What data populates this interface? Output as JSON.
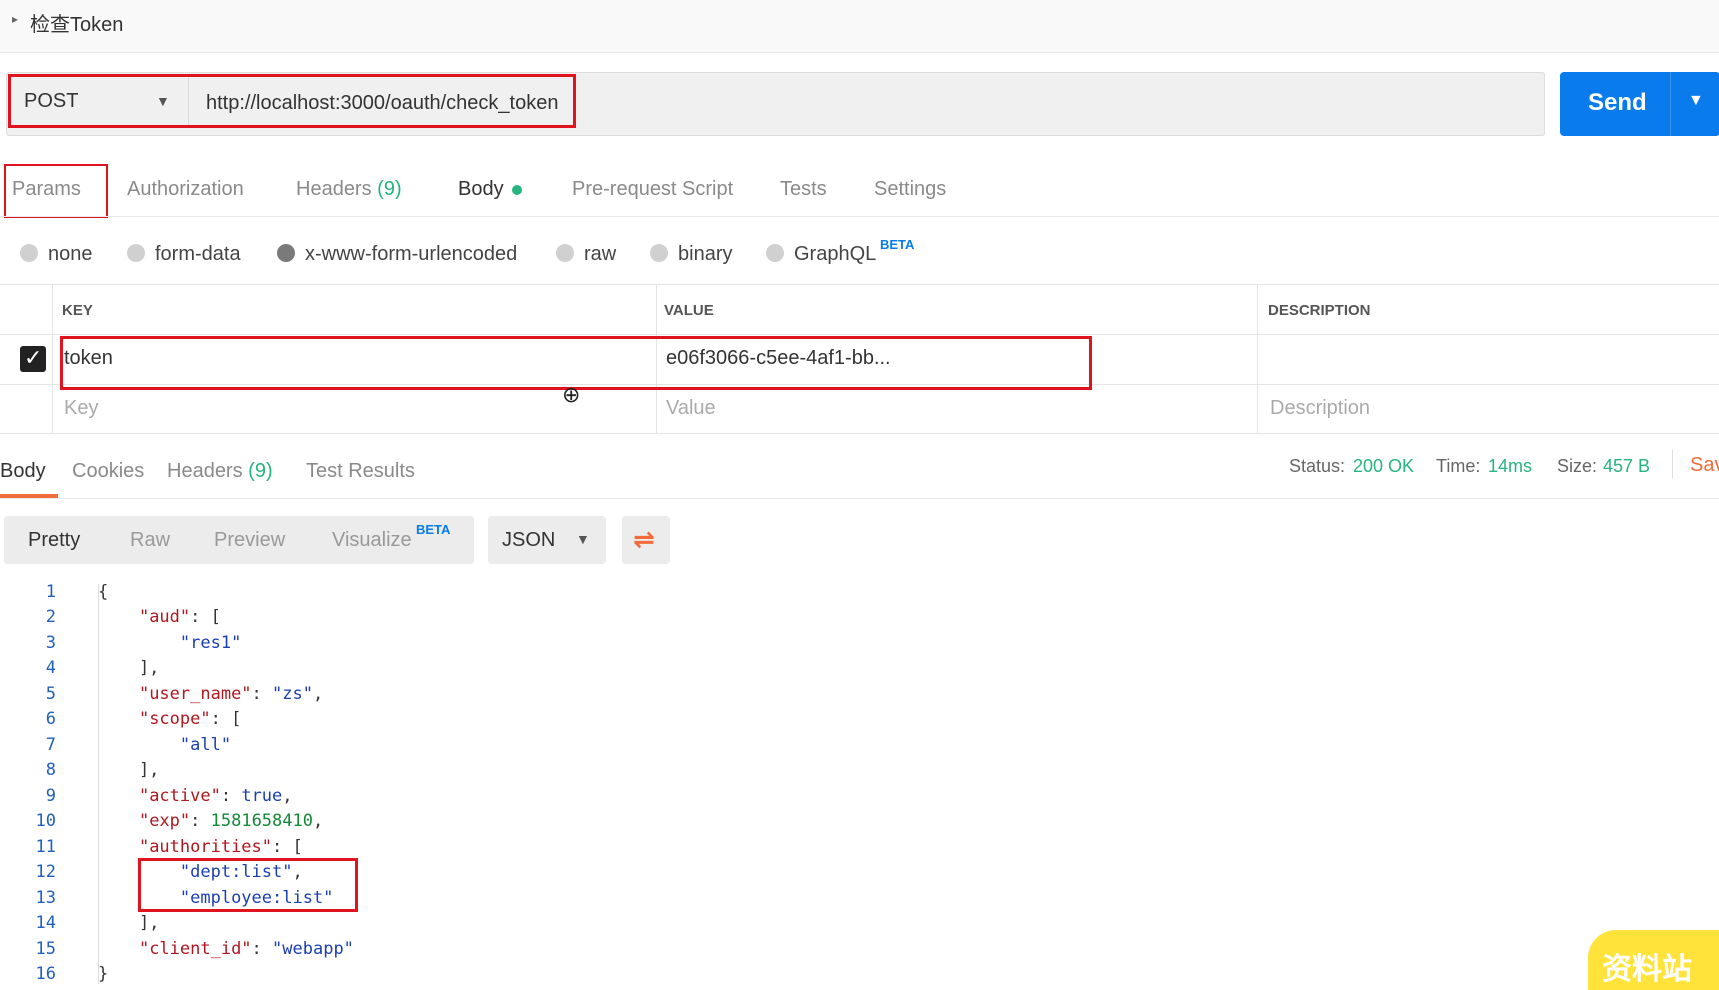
{
  "header": {
    "title": "检查Token",
    "caret": "▸"
  },
  "request": {
    "method": "POST",
    "url": "http://localhost:3000/oauth/check_token",
    "send_label": "Send"
  },
  "request_tabs": [
    {
      "label": "Params"
    },
    {
      "label": "Authorization"
    },
    {
      "label": "Headers",
      "count": "(9)"
    },
    {
      "label": "Body"
    },
    {
      "label": "Pre-request Script"
    },
    {
      "label": "Tests"
    },
    {
      "label": "Settings"
    }
  ],
  "body_types": [
    {
      "label": "none"
    },
    {
      "label": "form-data"
    },
    {
      "label": "x-www-form-urlencoded",
      "selected": true
    },
    {
      "label": "raw"
    },
    {
      "label": "binary"
    },
    {
      "label": "GraphQL"
    }
  ],
  "graphql_badge": "BETA",
  "params_table": {
    "headers": [
      "KEY",
      "VALUE",
      "DESCRIPTION"
    ],
    "rows": [
      {
        "checked": true,
        "key": "token",
        "value": "e06f3066-c5ee-4af1-bb..."
      }
    ],
    "placeholders": {
      "key": "Key",
      "value": "Value",
      "description": "Description"
    }
  },
  "response_tabs": [
    {
      "label": "Body"
    },
    {
      "label": "Cookies"
    },
    {
      "label": "Headers",
      "count": "(9)"
    },
    {
      "label": "Test Results"
    }
  ],
  "response_status": {
    "status_label": "Status:",
    "status_value": "200 OK",
    "time_label": "Time:",
    "time_value": "14ms",
    "size_label": "Size:",
    "size_value": "457 B",
    "save_label": "Sav"
  },
  "view_options": [
    "Pretty",
    "Raw",
    "Preview",
    "Visualize"
  ],
  "visualize_badge": "BETA",
  "language": "JSON",
  "code_lines": [
    {
      "n": "1"
    },
    {
      "n": "2"
    },
    {
      "n": "3"
    },
    {
      "n": "4"
    },
    {
      "n": "5"
    },
    {
      "n": "6"
    },
    {
      "n": "7"
    },
    {
      "n": "8"
    },
    {
      "n": "9"
    },
    {
      "n": "10"
    },
    {
      "n": "11"
    },
    {
      "n": "12"
    },
    {
      "n": "13"
    },
    {
      "n": "14"
    },
    {
      "n": "15"
    },
    {
      "n": "16"
    }
  ],
  "json_body": {
    "aud_key": "\"aud\"",
    "aud_item": "\"res1\"",
    "user_name_key": "\"user_name\"",
    "user_name_val": "\"zs\"",
    "scope_key": "\"scope\"",
    "scope_item": "\"all\"",
    "active_key": "\"active\"",
    "active_val": "true",
    "exp_key": "\"exp\"",
    "exp_val": "1581658410",
    "authorities_key": "\"authorities\"",
    "auth_item1": "\"dept:list\"",
    "auth_item2": "\"employee:list\"",
    "client_id_key": "\"client_id\"",
    "client_id_val": "\"webapp\""
  },
  "watermark": "资料站",
  "colors": {
    "accent_blue": "#097bed",
    "accent_orange": "#f26b3a",
    "status_green": "#26b47f",
    "highlight_red": "#e0141e"
  }
}
